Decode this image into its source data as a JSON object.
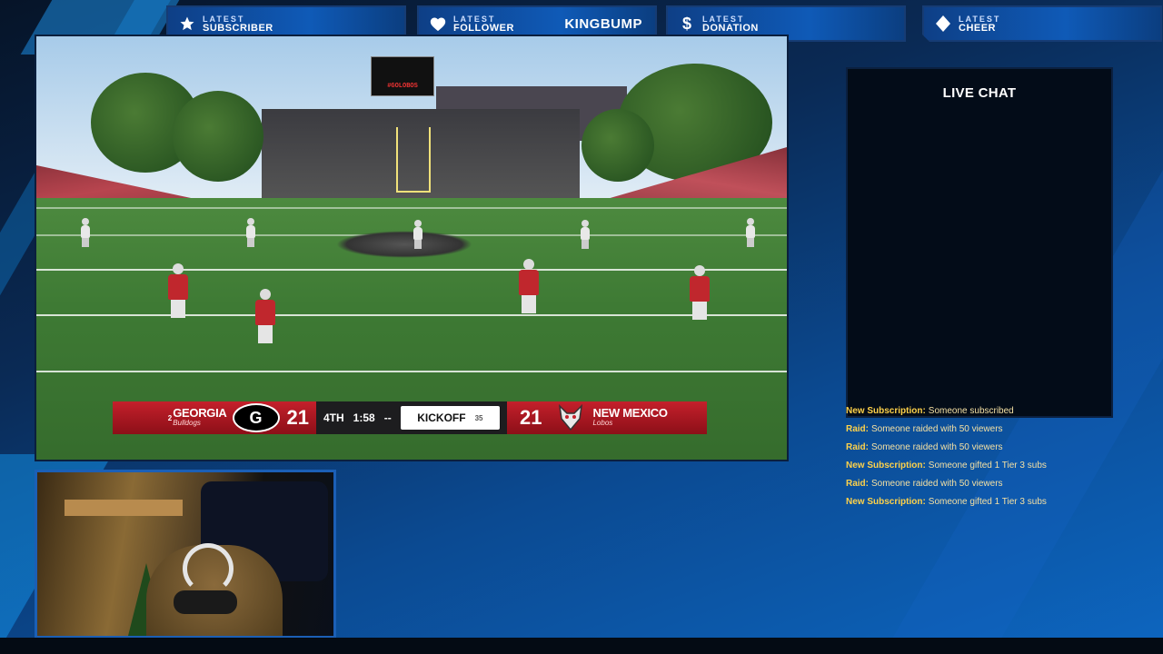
{
  "alerts": {
    "subscriber": {
      "small": "LATEST",
      "big": "SUBSCRIBER",
      "value": "",
      "icon": "star-icon"
    },
    "follower": {
      "small": "LATEST",
      "big": "FOLLOWER",
      "value": "KINGBUMP",
      "icon": "heart-icon"
    },
    "donation": {
      "small": "LATEST",
      "big": "DONATION",
      "value": "",
      "icon": "dollar-icon"
    },
    "cheer": {
      "small": "LATEST",
      "big": "CHEER",
      "value": "",
      "icon": "diamond-icon"
    }
  },
  "game": {
    "stadium_board": "#GOLOBOS",
    "scorebug": {
      "home": {
        "rank": "2",
        "name": "GEORGIA",
        "mascot": "Bulldogs",
        "score": "21",
        "logo": "G"
      },
      "quarter": "4TH",
      "clock": "1:58",
      "down": "--",
      "situation": "KICKOFF",
      "playclock": "35",
      "away": {
        "name": "NEW MEXICO",
        "mascot": "Lobos",
        "score": "21"
      }
    }
  },
  "chat": {
    "title": "LIVE CHAT",
    "events": [
      {
        "type": "New Subscription:",
        "message": "Someone subscribed"
      },
      {
        "type": "Raid:",
        "message": "Someone raided with 50 viewers"
      },
      {
        "type": "Raid:",
        "message": "Someone raided with 50 viewers"
      },
      {
        "type": "New Subscription:",
        "message": "Someone gifted 1 Tier 3 subs"
      },
      {
        "type": "Raid:",
        "message": "Someone raided with 50 viewers"
      },
      {
        "type": "New Subscription:",
        "message": "Someone gifted 1 Tier 3 subs"
      }
    ]
  },
  "colors": {
    "accent": "#0f5ab7",
    "georgia_red": "#c4202b",
    "chat_highlight": "#ffd24a"
  }
}
